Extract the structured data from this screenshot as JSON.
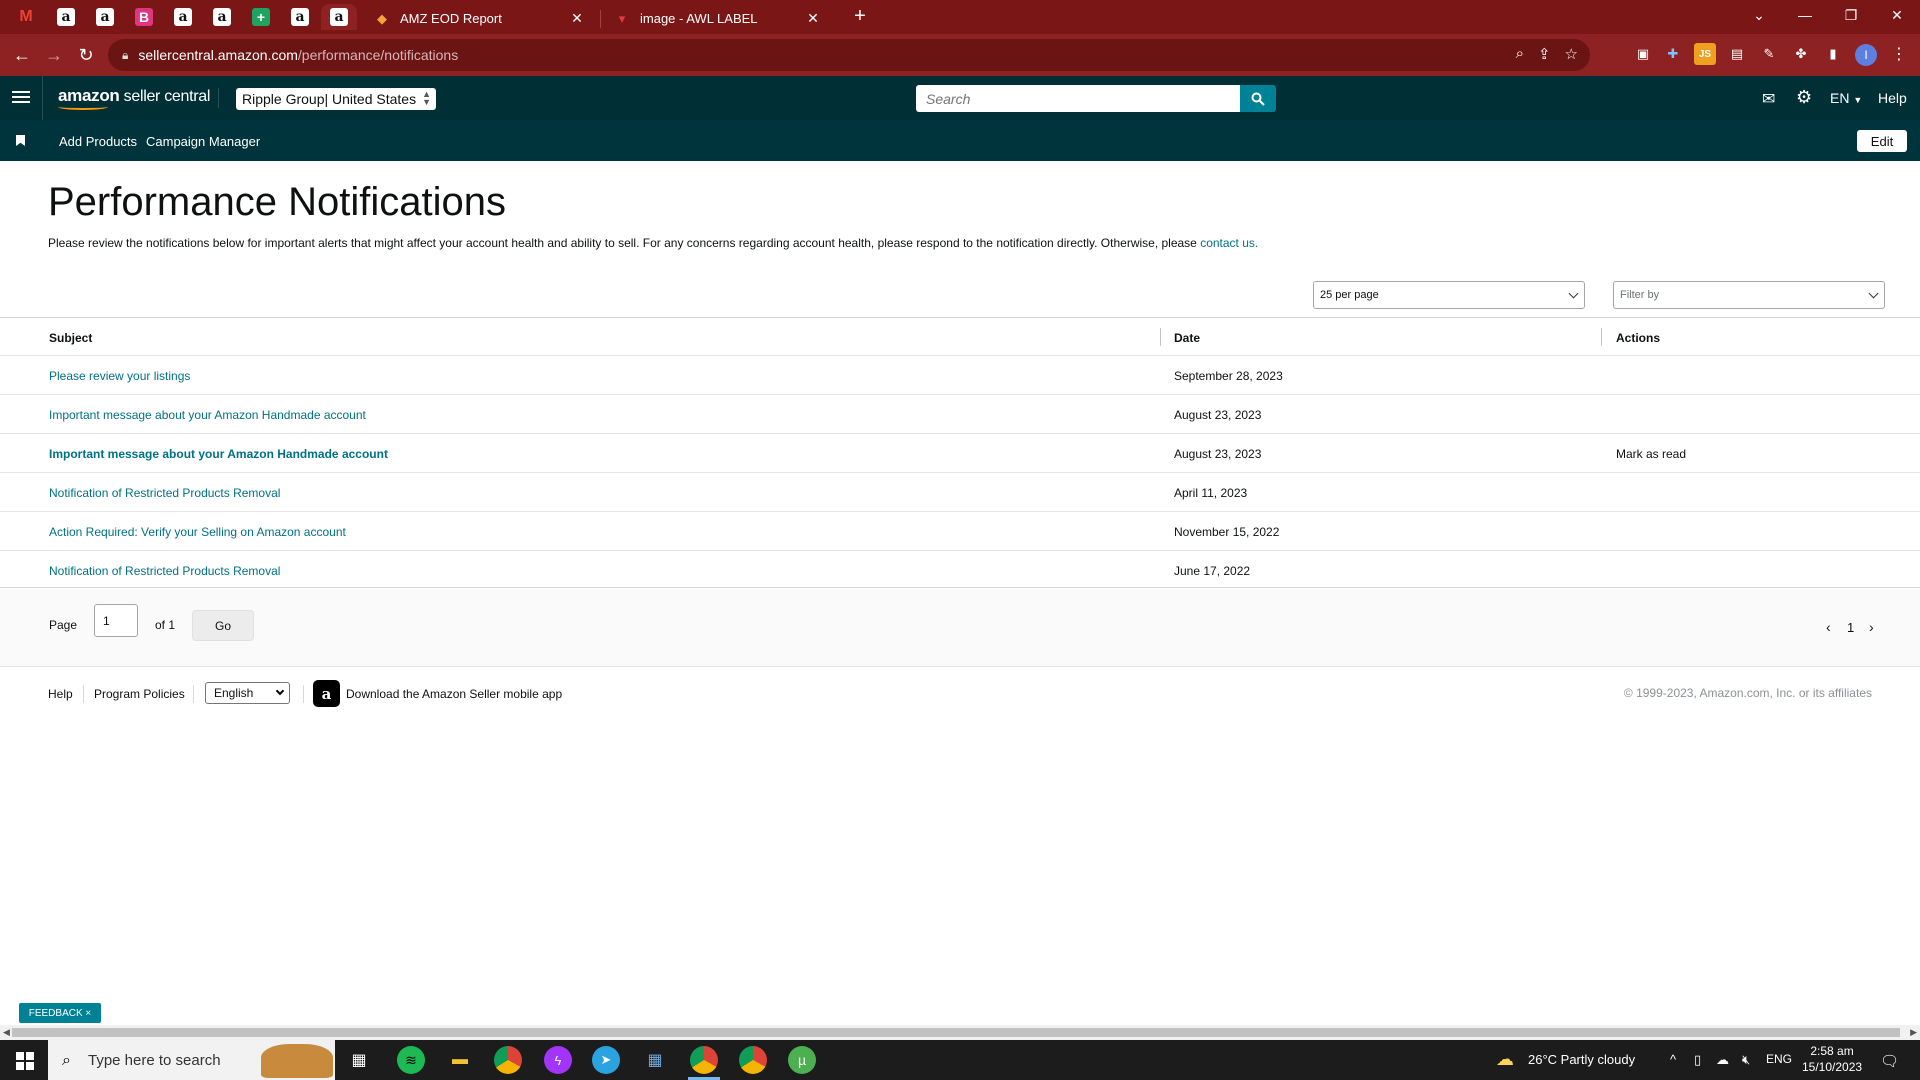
{
  "browser": {
    "pinned_tabs": [
      {
        "icon": "gmail-icon",
        "glyph": "M"
      },
      {
        "icon": "amazon-icon",
        "glyph": "a"
      },
      {
        "icon": "amazon-icon",
        "glyph": "a"
      },
      {
        "icon": "b-app-icon",
        "glyph": "B"
      },
      {
        "icon": "amazon-icon",
        "glyph": "a"
      },
      {
        "icon": "amazon-icon",
        "glyph": "a"
      },
      {
        "icon": "sheets-icon",
        "glyph": "+"
      },
      {
        "icon": "amazon-icon",
        "glyph": "a"
      },
      {
        "icon": "amazon-icon",
        "glyph": "a"
      }
    ],
    "tabs": [
      {
        "title": "AMZ EOD Report",
        "icon": "report-icon"
      },
      {
        "title": "image - AWL LABEL",
        "icon": "label-icon"
      }
    ],
    "url_host": "sellercentral.amazon.com",
    "url_path": "/performance/notifications",
    "profile_initial": "I",
    "colors": {
      "frame": "#7a1616",
      "toolbar": "#8e2121"
    }
  },
  "header": {
    "logo_brand": "amazon",
    "logo_sub": " seller central",
    "account_name": "Ripple Group",
    "account_market": " | United States",
    "search_placeholder": "Search",
    "language": "EN",
    "help": "Help",
    "colors": {
      "header": "#002f36",
      "search_button": "#008296"
    }
  },
  "bookmarks": {
    "items": [
      "Add Products",
      "Campaign Manager"
    ],
    "edit_label": "Edit"
  },
  "page": {
    "title": "Performance Notifications",
    "intro": "Please review the notifications below for important alerts that might affect your account health and ability to sell. For any concerns regarding account health, please respond to the notification directly. Otherwise, please ",
    "intro_link": "contact us.",
    "per_page": "25 per page",
    "filter_placeholder": "Filter by"
  },
  "table": {
    "headers": {
      "subject": "Subject",
      "date": "Date",
      "actions": "Actions"
    },
    "rows": [
      {
        "subject": "Please review your listings",
        "date": "September 28, 2023",
        "action": "",
        "unread": false
      },
      {
        "subject": "Important message about your Amazon Handmade account",
        "date": "August 23, 2023",
        "action": "",
        "unread": false
      },
      {
        "subject": "Important message about your Amazon Handmade account",
        "date": "August 23, 2023",
        "action": "Mark as read",
        "unread": true
      },
      {
        "subject": "Notification of Restricted Products Removal",
        "date": "April 11, 2023",
        "action": "",
        "unread": false
      },
      {
        "subject": "Action Required: Verify your Selling on Amazon account",
        "date": "November 15, 2022",
        "action": "",
        "unread": false
      },
      {
        "subject": "Notification of Restricted Products Removal",
        "date": "June 17, 2022",
        "action": "",
        "unread": false
      }
    ]
  },
  "pager": {
    "page_label": "Page",
    "page_value": "1",
    "of_label": "of 1",
    "go_label": "Go",
    "current": "1"
  },
  "footer": {
    "help": "Help",
    "policies": "Program Policies",
    "language": "English",
    "app_text": "Download the Amazon Seller mobile app",
    "copyright": "© 1999-2023, Amazon.com, Inc. or its affiliates"
  },
  "feedback_label": "FEEDBACK ×",
  "taskbar": {
    "search_placeholder": "Type here to search",
    "weather": "26°C  Partly cloudy",
    "lang": "ENG",
    "time": "2:58 am",
    "date": "15/10/2023"
  }
}
